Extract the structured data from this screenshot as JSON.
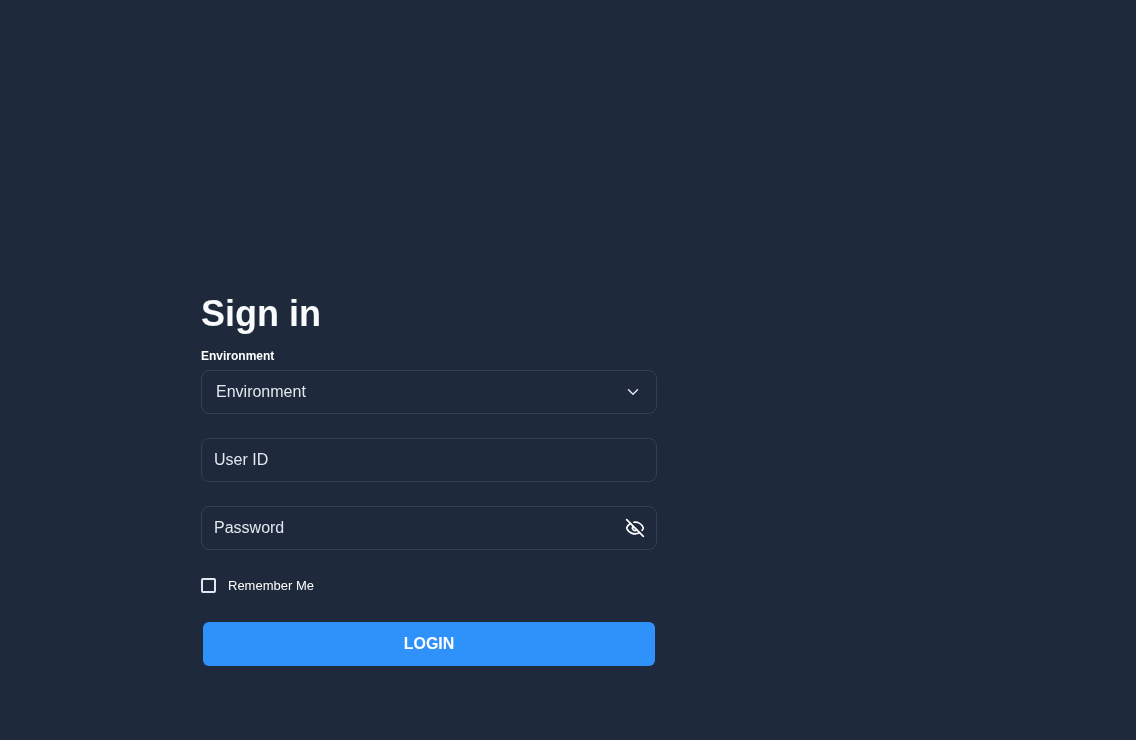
{
  "title": "Sign in",
  "environment": {
    "label": "Environment",
    "placeholder": "Environment"
  },
  "user_id": {
    "placeholder": "User ID"
  },
  "password": {
    "placeholder": "Password",
    "visible": false
  },
  "remember_me": {
    "label": "Remember Me",
    "checked": false
  },
  "login_button": {
    "label": "LOGIN"
  }
}
